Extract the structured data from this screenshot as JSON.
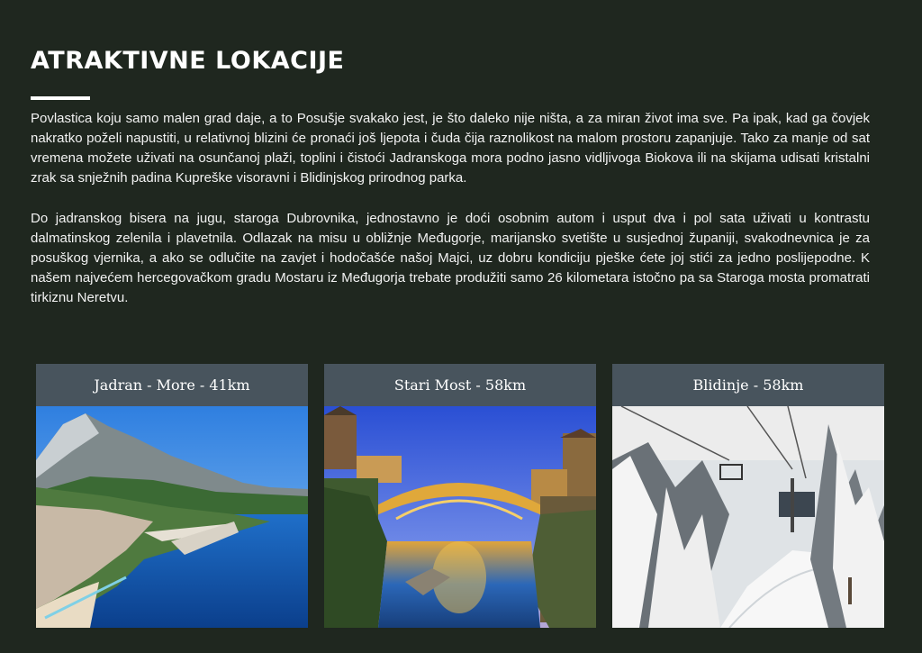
{
  "section": {
    "title": "ATRAKTIVNE LOKACIJE",
    "paragraphs": [
      "Povlastica koju samo malen grad daje, a to Posušje svakako jest, je što daleko nije ništa, a za miran život ima sve. Pa ipak, kad ga čovjek nakratko poželi napustiti, u relativnoj blizini će pronaći još ljepota i čuda čija raznolikost na malom prostoru zapanjuje. Tako za manje od sat vremena možete uživati na osunčanoj plaži, toplini i čistoći Jadranskoga mora podno jasno vidljivoga Biokova ili na skijama udisati kristalni zrak sa snježnih padina Kupreške visoravni i Blidinjskog prirodnog parka.",
      "Do jadranskog bisera na jugu, staroga Dubrovnika, jednostavno je doći osobnim autom i usput dva i pol sata uživati u kontrastu dalmatinskog zelenila i plavetnila. Odlazak na misu u obližnje Međugorje, marijansko svetište u susjednoj županiji, svakodnevnica je za posuškog vjernika, a ako se odlučite na zavjet i hodočašće našoj Majci, uz dobru kondiciju pješke ćete joj stići za jedno poslijepodne. K našem najvećem hercegovačkom gradu Mostaru iz Međugorja trebate produžiti samo 26 kilometara istočno pa sa Staroga mosta promatrati tirkiznu Neretvu."
    ]
  },
  "cards": [
    {
      "label": "Jadran - More - 41km"
    },
    {
      "label": "Stari Most - 58km"
    },
    {
      "label": "Blidinje - 58km"
    }
  ],
  "colors": {
    "background": "#1f271f",
    "card_label_bg": "#48545d",
    "text": "#ffffff"
  }
}
